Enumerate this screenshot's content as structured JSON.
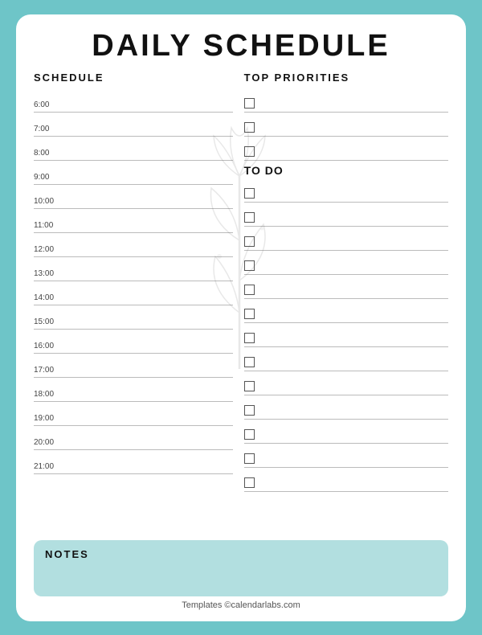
{
  "title": "DAILY SCHEDULE",
  "schedule_header": "SCHEDULE",
  "priorities_header": "TOP PRIORITIES",
  "todo_header": "TO DO",
  "notes_header": "NOTES",
  "footer": "Templates ©calendarlabs.com",
  "time_slots": [
    "6:00",
    "7:00",
    "8:00",
    "9:00",
    "10:00",
    "11:00",
    "12:00",
    "13:00",
    "14:00",
    "15:00",
    "16:00",
    "17:00",
    "18:00",
    "19:00",
    "20:00",
    "21:00"
  ],
  "priority_count": 3,
  "todo_count": 13
}
